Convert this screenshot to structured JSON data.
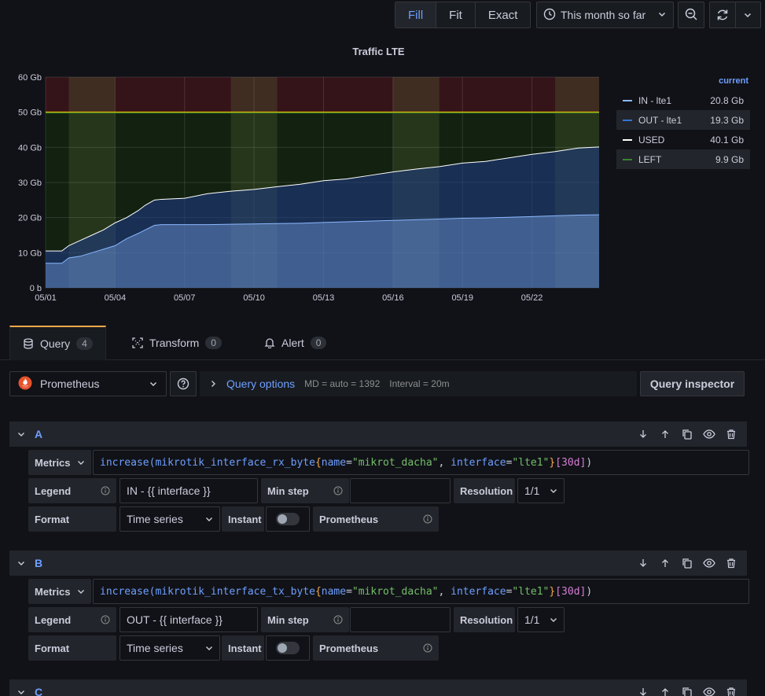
{
  "toolbar": {
    "fill_label": "Fill",
    "fit_label": "Fit",
    "exact_label": "Exact",
    "time_range": "This month so far"
  },
  "panel": {
    "title": "Traffic LTE"
  },
  "legend": {
    "header": "current",
    "items": [
      {
        "name": "IN - lte1",
        "value": "20.8 Gb",
        "color": "#8ab8ff"
      },
      {
        "name": "OUT - lte1",
        "value": "19.3 Gb",
        "color": "#3274d9"
      },
      {
        "name": "USED",
        "value": "40.1 Gb",
        "color": "#ffffff"
      },
      {
        "name": "LEFT",
        "value": "9.9 Gb",
        "color": "#37872d"
      }
    ]
  },
  "chart_data": {
    "type": "area",
    "title": "Traffic LTE",
    "ylim": [
      0,
      60
    ],
    "y_ticks": [
      "0 b",
      "10 Gb",
      "20 Gb",
      "30 Gb",
      "40 Gb",
      "50 Gb",
      "60 Gb"
    ],
    "x_ticks": [
      "05/01",
      "05/04",
      "05/07",
      "05/10",
      "05/13",
      "05/16",
      "05/19",
      "05/22"
    ],
    "xlim": [
      0,
      23.9
    ],
    "threshold": 50,
    "series": [
      {
        "name": "IN - lte1",
        "x": [
          0,
          0.7,
          1,
          1.5,
          2,
          2.5,
          3,
          3.5,
          4,
          4.3,
          4.7,
          5,
          6,
          7,
          8,
          9,
          10,
          11,
          12,
          13,
          14,
          15,
          16,
          17,
          18,
          19,
          20,
          21,
          22,
          23,
          23.9
        ],
        "values": [
          7,
          7,
          8.5,
          9,
          10,
          11,
          12,
          14,
          15.5,
          16.5,
          17.8,
          18,
          18,
          18,
          18.1,
          18.2,
          18.3,
          18.4,
          18.6,
          18.8,
          19,
          19.2,
          19.4,
          19.6,
          19.8,
          19.9,
          20.1,
          20.3,
          20.5,
          20.7,
          20.8
        ]
      },
      {
        "name": "USED",
        "x": [
          0,
          0.7,
          1,
          1.5,
          2,
          2.5,
          3,
          3.5,
          4,
          4.3,
          4.7,
          5,
          6,
          7,
          8,
          9,
          10,
          11,
          12,
          13,
          14,
          15,
          16,
          17,
          18,
          19,
          20,
          21,
          22,
          23,
          23.9
        ],
        "values": [
          10.5,
          10.5,
          12,
          13.5,
          15,
          16.5,
          18.5,
          20,
          22,
          23.5,
          25,
          25.2,
          25.5,
          26.8,
          27.5,
          28,
          28.8,
          29.5,
          30.5,
          31,
          32,
          33,
          33.8,
          34.5,
          35.5,
          36,
          37,
          38,
          38.8,
          39.8,
          40.1
        ]
      }
    ]
  },
  "tabs": [
    {
      "label": "Query",
      "count": "4"
    },
    {
      "label": "Transform",
      "count": "0"
    },
    {
      "label": "Alert",
      "count": "0"
    }
  ],
  "query_header": {
    "datasource": "Prometheus",
    "options_title": "Query options",
    "md": "MD = auto = 1392",
    "interval": "Interval = 20m",
    "inspector": "Query inspector"
  },
  "queries": [
    {
      "letter": "A",
      "expr_fn": "increase(mikrotik_interface_rx_byte",
      "legend": "IN - {{ interface }}"
    },
    {
      "letter": "B",
      "expr_fn": "increase(mikrotik_interface_tx_byte",
      "legend": "OUT - {{ interface }}"
    },
    {
      "letter": "C"
    }
  ],
  "fields": {
    "metrics": "Metrics",
    "legend": "Legend",
    "min_step": "Min step",
    "resolution": "Resolution",
    "resolution_value": "1/1",
    "format": "Format",
    "format_value": "Time series",
    "instant": "Instant",
    "prometheus": "Prometheus"
  },
  "expr_parts": {
    "open_brace": "{",
    "name_key": "name",
    "eq": "=",
    "name_val": "\"mikrot_dacha\"",
    "sep": ", ",
    "iface_key": "interface",
    "iface_val": "\"lte1\"",
    "close_brace": "}",
    "dur": "[30d]",
    "close_paren": ")"
  }
}
